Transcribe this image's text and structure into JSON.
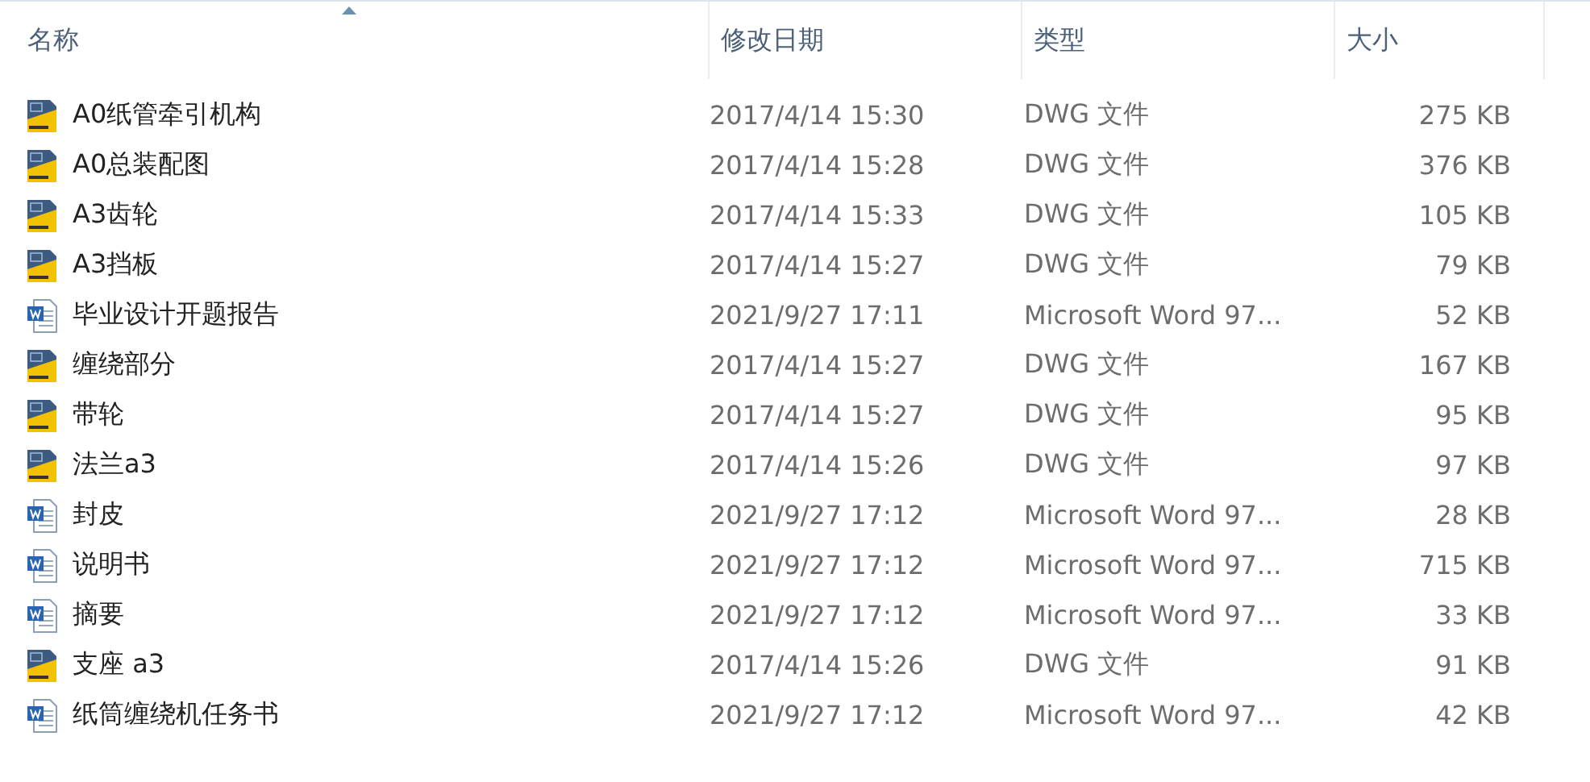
{
  "columns": [
    {
      "label": "名称",
      "sorted": true
    },
    {
      "label": "修改日期",
      "sorted": false
    },
    {
      "label": "类型",
      "sorted": false
    },
    {
      "label": "大小",
      "sorted": false
    }
  ],
  "files": [
    {
      "kind": "dwg",
      "name": "A0纸管牵引机构",
      "date": "2017/4/14 15:30",
      "type": "DWG 文件",
      "size": "275 KB"
    },
    {
      "kind": "dwg",
      "name": "A0总装配图",
      "date": "2017/4/14 15:28",
      "type": "DWG 文件",
      "size": "376 KB"
    },
    {
      "kind": "dwg",
      "name": "A3齿轮",
      "date": "2017/4/14 15:33",
      "type": "DWG 文件",
      "size": "105 KB"
    },
    {
      "kind": "dwg",
      "name": "A3挡板",
      "date": "2017/4/14 15:27",
      "type": "DWG 文件",
      "size": "79 KB"
    },
    {
      "kind": "word",
      "name": "毕业设计开题报告",
      "date": "2021/9/27 17:11",
      "type": "Microsoft Word 97...",
      "size": "52 KB"
    },
    {
      "kind": "dwg",
      "name": "缠绕部分",
      "date": "2017/4/14 15:27",
      "type": "DWG 文件",
      "size": "167 KB"
    },
    {
      "kind": "dwg",
      "name": "带轮",
      "date": "2017/4/14 15:27",
      "type": "DWG 文件",
      "size": "95 KB"
    },
    {
      "kind": "dwg",
      "name": "法兰a3",
      "date": "2017/4/14 15:26",
      "type": "DWG 文件",
      "size": "97 KB"
    },
    {
      "kind": "word",
      "name": "封皮",
      "date": "2021/9/27 17:12",
      "type": "Microsoft Word 97...",
      "size": "28 KB"
    },
    {
      "kind": "word",
      "name": "说明书",
      "date": "2021/9/27 17:12",
      "type": "Microsoft Word 97...",
      "size": "715 KB"
    },
    {
      "kind": "word",
      "name": "摘要",
      "date": "2021/9/27 17:12",
      "type": "Microsoft Word 97...",
      "size": "33 KB"
    },
    {
      "kind": "dwg",
      "name": "支座 a3",
      "date": "2017/4/14 15:26",
      "type": "DWG 文件",
      "size": "91 KB"
    },
    {
      "kind": "word",
      "name": "纸筒缠绕机任务书",
      "date": "2021/9/27 17:12",
      "type": "Microsoft Word 97...",
      "size": "42 KB"
    }
  ]
}
